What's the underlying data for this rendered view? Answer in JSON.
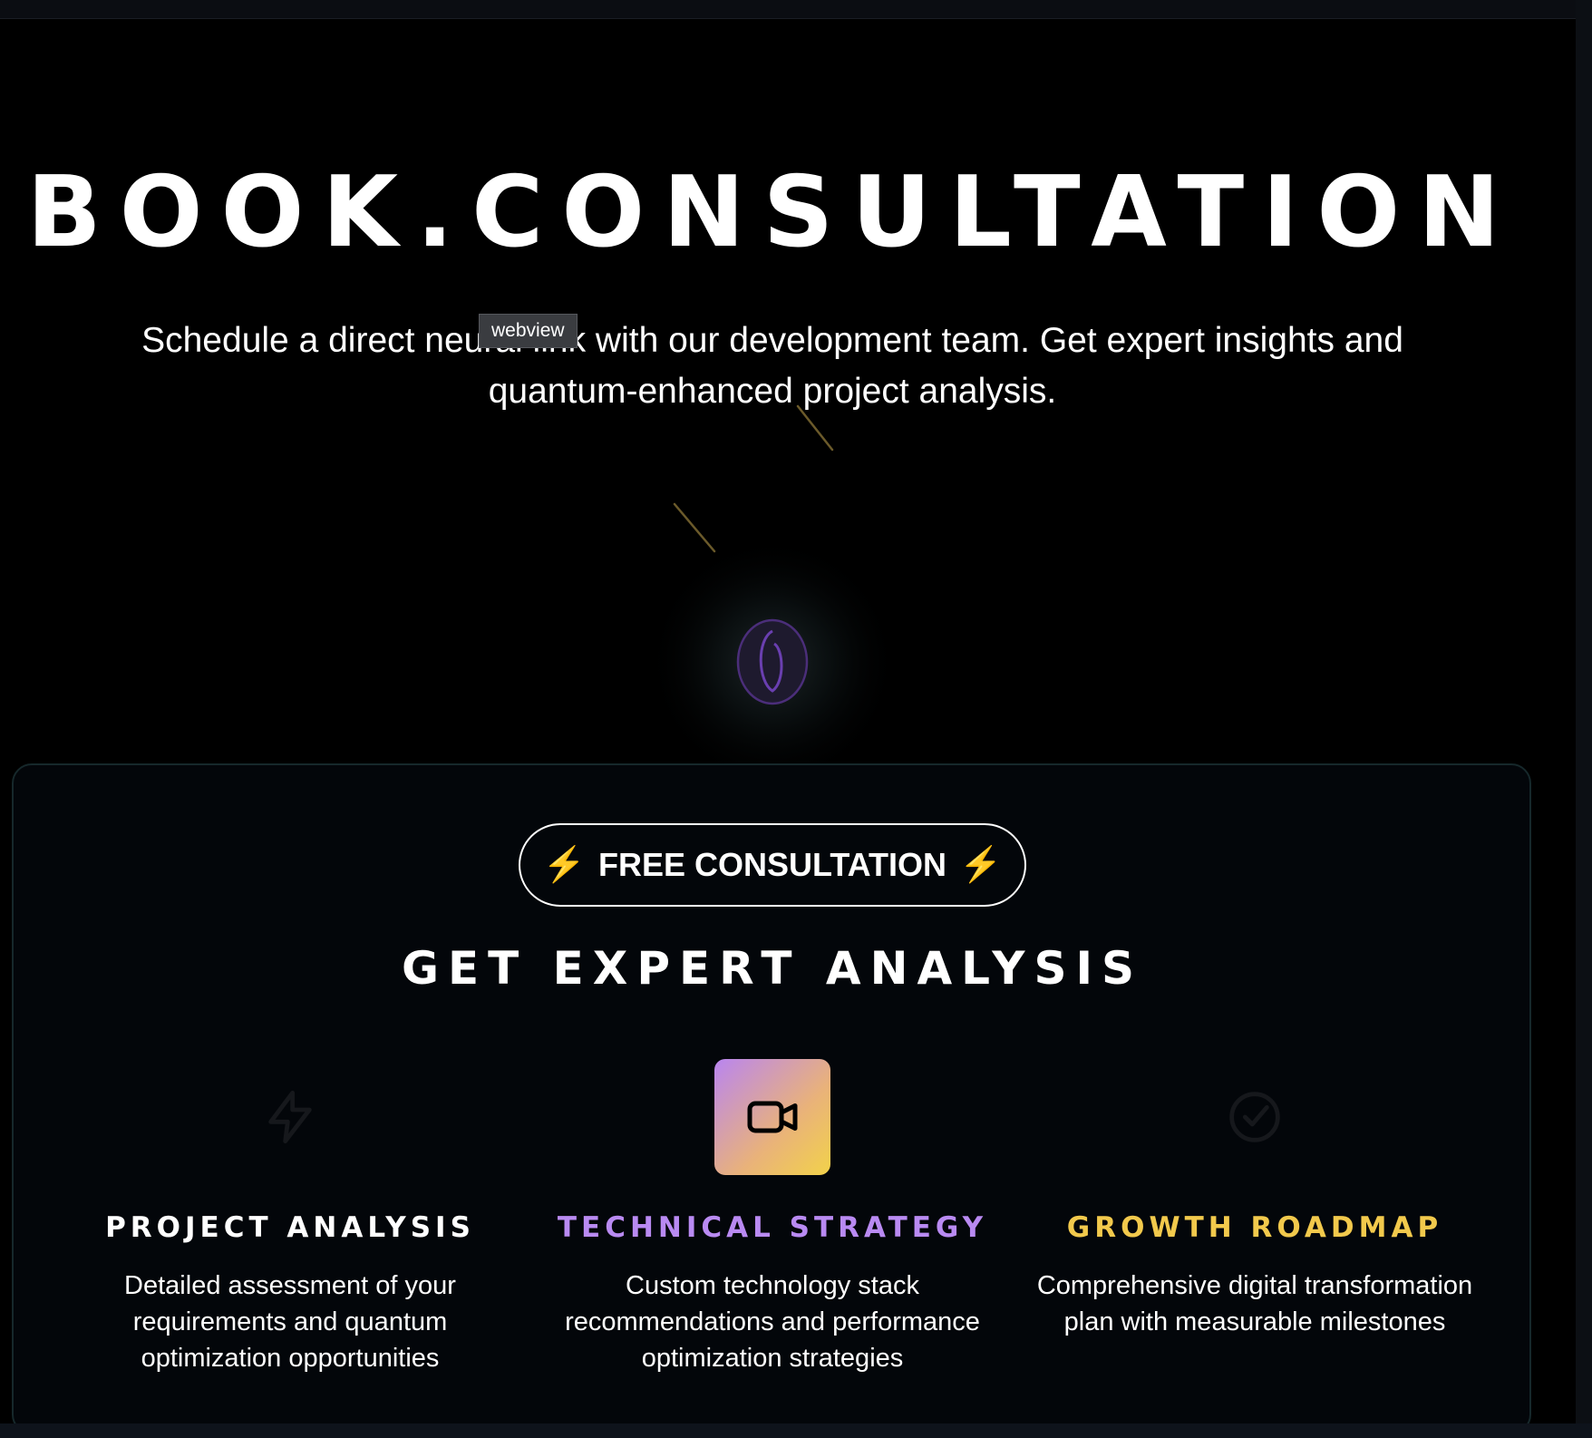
{
  "hero": {
    "title": "BOOK.CONSULTATION",
    "subtitle": "Schedule a direct neural link with our development team. Get expert insights and quantum-enhanced project analysis."
  },
  "tooltip": {
    "label": "webview"
  },
  "panel": {
    "badge": {
      "label": "FREE CONSULTATION",
      "icon_left": "lightning-icon",
      "icon_right": "lightning-icon",
      "bolt_glyph": "⚡"
    },
    "section_title": "GET EXPERT ANALYSIS",
    "features": [
      {
        "icon": "lightning-icon",
        "title": "PROJECT ANALYSIS",
        "description": "Detailed assessment of your requirements and quantum optimization opportunities",
        "title_color": "#ffffff"
      },
      {
        "icon": "video-camera-icon",
        "title": "TECHNICAL STRATEGY",
        "description": "Custom technology stack recommendations and performance optimization strategies",
        "title_color": "#b98af2"
      },
      {
        "icon": "check-circle-icon",
        "title": "GROWTH ROADMAP",
        "description": "Comprehensive digital transformation plan with measurable milestones",
        "title_color": "#f2c94c"
      }
    ]
  },
  "colors": {
    "background": "#000000",
    "panel_bg": "#03060a",
    "panel_border": "#16282b",
    "accent_purple": "#b98af2",
    "accent_gold": "#f2c94c"
  }
}
